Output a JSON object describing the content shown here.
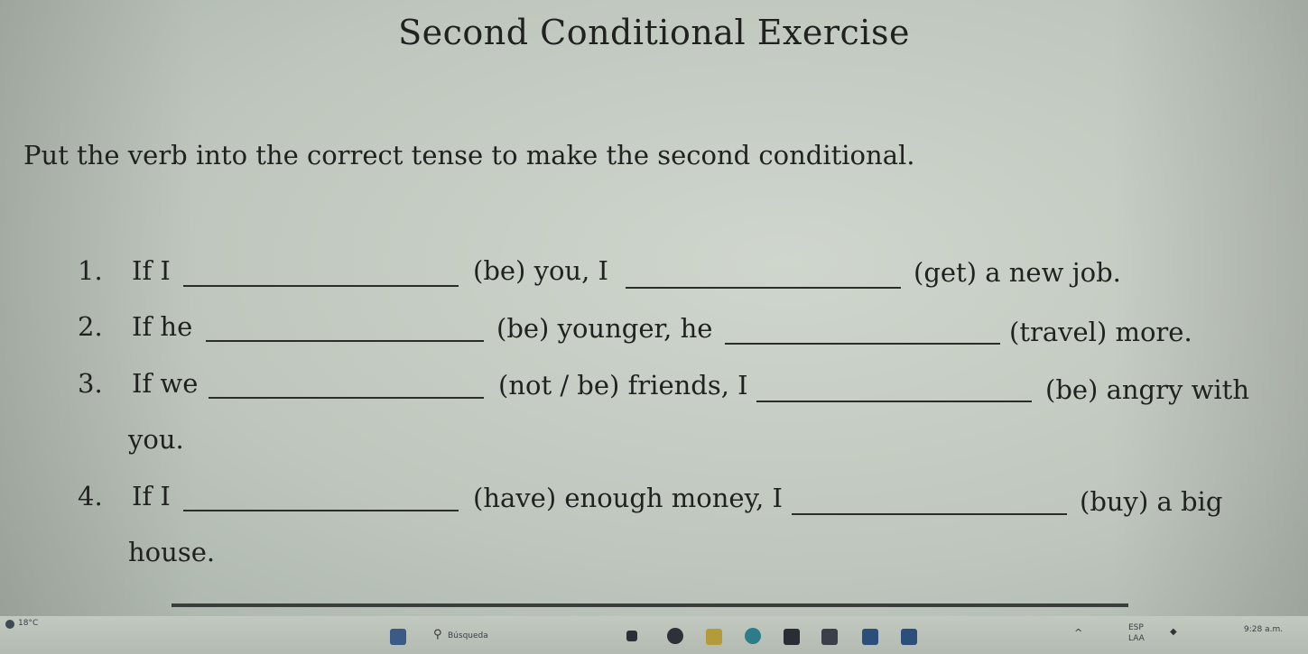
{
  "title": "Second Conditional Exercise",
  "instructions": "Put the verb into the correct tense to make the second conditional.",
  "items": [
    {
      "number": "1.",
      "part1": "If I",
      "part2": "(be) you, I",
      "part3": "(get) a new job.",
      "continuation": ""
    },
    {
      "number": "2.",
      "part1": "If he",
      "part2": "(be) younger, he",
      "part3": "(travel) more.",
      "continuation": ""
    },
    {
      "number": "3.",
      "part1": "If we",
      "part2": "(not / be) friends, I",
      "part3": "(be) angry with",
      "continuation": "you."
    },
    {
      "number": "4.",
      "part1": "If I",
      "part2": "(have) enough money, I",
      "part3": "(buy) a big",
      "continuation": "house."
    }
  ],
  "taskbar": {
    "weather": "18°C",
    "search_placeholder": "Búsqueda",
    "lang": "ESP",
    "lang2": "LAA",
    "time": "9:28 a.m."
  },
  "colors": {
    "background": "#c5ccc3",
    "text": "#1f221e"
  }
}
